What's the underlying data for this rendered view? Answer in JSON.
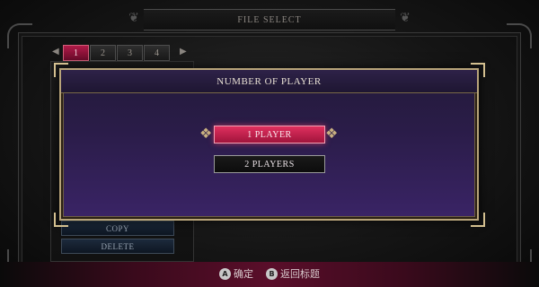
{
  "header": {
    "title": "FILE SELECT"
  },
  "tabs": [
    {
      "label": "1",
      "active": true
    },
    {
      "label": "2",
      "active": false
    },
    {
      "label": "3",
      "active": false
    },
    {
      "label": "4",
      "active": false
    }
  ],
  "side_menu": {
    "copy_label": "COPY",
    "delete_label": "DELETE"
  },
  "dialog": {
    "title": "NUMBER OF PLAYER",
    "options": [
      {
        "label": "1 PLAYER",
        "selected": true
      },
      {
        "label": "2 PLAYERS",
        "selected": false
      }
    ]
  },
  "hints": [
    {
      "button": "A",
      "label": "确定"
    },
    {
      "button": "B",
      "label": "返回标题"
    }
  ],
  "colors": {
    "accent": "#c01a48",
    "dialog_bg": "#2a1c48",
    "gold_border": "#b8a47a"
  }
}
